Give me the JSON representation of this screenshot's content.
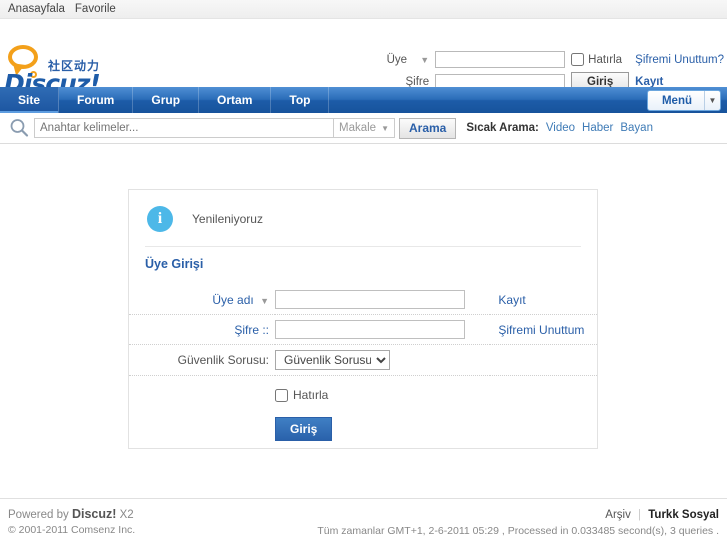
{
  "topbar": {
    "links": [
      {
        "label": "Anasayfala"
      },
      {
        "label": "Favorile"
      }
    ]
  },
  "logo": {
    "chinese": "社区动力",
    "wordmark": "Discuz!"
  },
  "header_login": {
    "user_label": "Üye",
    "password_label": "Şifre",
    "username_value": "",
    "password_value": "",
    "remember_label": "Hatırla",
    "submit_label": "Giriş",
    "forgot_label": "Şifremi Unuttum?",
    "register_label": "Kayıt"
  },
  "nav": {
    "items": [
      {
        "label": "Site",
        "active": true
      },
      {
        "label": "Forum",
        "active": false
      },
      {
        "label": "Grup",
        "active": false
      },
      {
        "label": "Ortam",
        "active": false
      },
      {
        "label": "Top",
        "active": false
      }
    ],
    "menu_label": "Menü"
  },
  "search": {
    "placeholder": "Anahtar kelimeler...",
    "value": "",
    "category": "Makale",
    "button_label": "Arama",
    "hot_label": "Sıcak Arama:",
    "hot_links": [
      {
        "label": "Video"
      },
      {
        "label": "Haber"
      },
      {
        "label": "Bayan"
      }
    ]
  },
  "panel": {
    "notice": "Yenileniyoruz",
    "title": "Üye Girişi",
    "username_label": "Üye adı",
    "username_value": "",
    "username_link": "Kayıt",
    "password_label": "Şifre ::",
    "password_value": "",
    "password_link": "Şifremi Unuttum",
    "question_label": "Güvenlik Sorusu:",
    "question_value": "Güvenlik Sorusu",
    "remember_label": "Hatırla",
    "submit_label": "Giriş"
  },
  "footer": {
    "powered_prefix": "Powered by",
    "powered_brand": "Discuz!",
    "powered_version": "X2",
    "copyright": "© 2001-2011 Comsenz Inc.",
    "archive_label": "Arşiv",
    "site_label": "Turkk Sosyal",
    "stats": "Tüm zamanlar GMT+1, 2-6-2011 05:29 , Processed in 0.033485 second(s), 3 queries ."
  },
  "colors": {
    "nav_blue": "#1d5ca8",
    "link_blue": "#2a5fa8",
    "logo_orange": "#f3a01a",
    "info_cyan": "#4db8e8"
  }
}
